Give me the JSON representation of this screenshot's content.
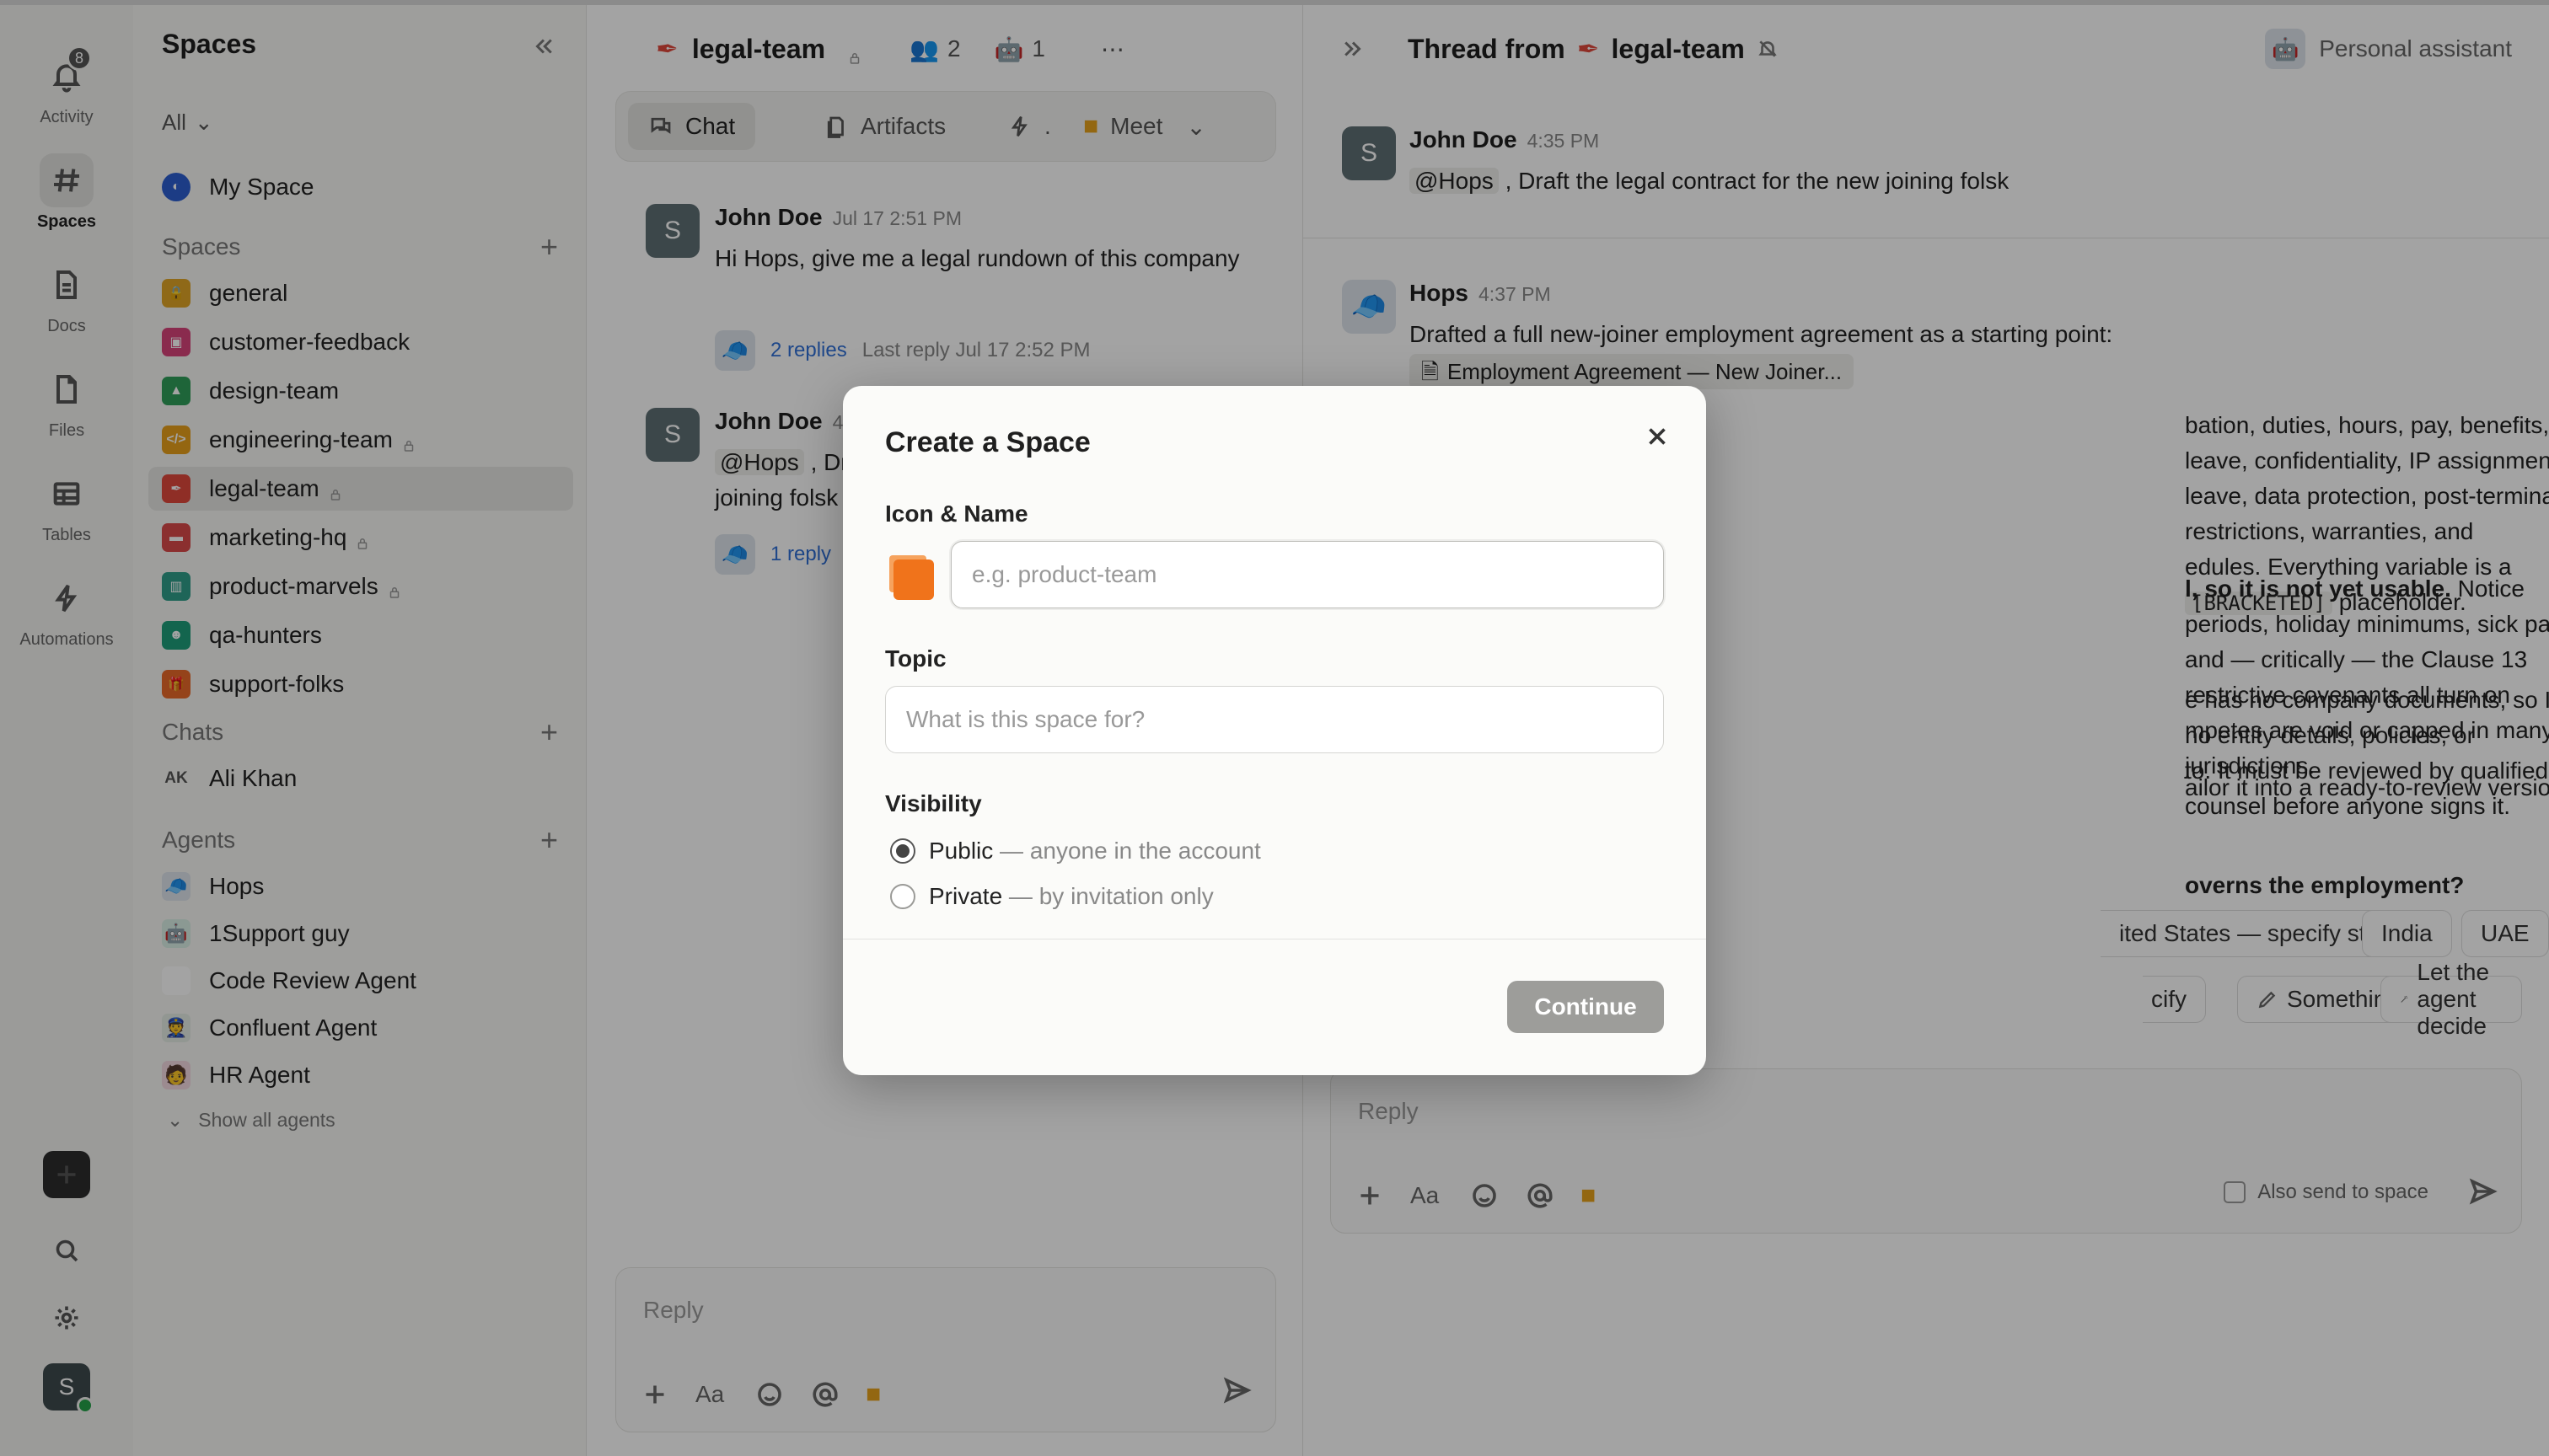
{
  "rail": {
    "activity": {
      "label": "Activity",
      "badge": "8"
    },
    "spaces": {
      "label": "Spaces"
    },
    "docs": {
      "label": "Docs"
    },
    "files": {
      "label": "Files"
    },
    "tables": {
      "label": "Tables"
    },
    "automations": {
      "label": "Automations"
    },
    "user_initial": "S"
  },
  "sidebar": {
    "title": "Spaces",
    "filter": "All",
    "my_space": "My Space",
    "spaces_header": "Spaces",
    "spaces": [
      {
        "name": "general",
        "color": "#e0a526",
        "private": false
      },
      {
        "name": "customer-feedback",
        "color": "#d8447a",
        "private": false
      },
      {
        "name": "design-team",
        "color": "#2f9e5a",
        "private": false
      },
      {
        "name": "engineering-team",
        "color": "#e8a01c",
        "private": true
      },
      {
        "name": "legal-team",
        "color": "#e0483c",
        "private": true
      },
      {
        "name": "marketing-hq",
        "color": "#d94a4a",
        "private": true
      },
      {
        "name": "product-marvels",
        "color": "#2f9e8a",
        "private": true
      },
      {
        "name": "qa-hunters",
        "color": "#1f9e7a",
        "private": false
      },
      {
        "name": "support-folks",
        "color": "#ea6a2a",
        "private": false
      }
    ],
    "chats_header": "Chats",
    "chats": [
      {
        "initials": "AK",
        "name": "Ali Khan"
      }
    ],
    "agents_header": "Agents",
    "agents": [
      "Hops",
      "1Support guy",
      "Code Review Agent",
      "Confluent Agent",
      "HR Agent"
    ],
    "show_all": "Show all agents"
  },
  "channel": {
    "name": "legal-team",
    "members": "2",
    "agents": "1",
    "tabs": {
      "chat": "Chat",
      "artifacts": "Artifacts",
      "meet": "Meet",
      "auto": "."
    },
    "messages": [
      {
        "initial": "S",
        "author": "John Doe",
        "time": "Jul 17 2:51 PM",
        "text": "Hi Hops, give me a legal rundown of this company",
        "replies": "2 replies",
        "last": "Last reply Jul 17 2:52 PM"
      },
      {
        "initial": "S",
        "author": "John Doe",
        "time": "4",
        "mention": "@Hops",
        "text_after": " , Dr",
        "text2": "joining folsk",
        "replies": "1 reply"
      }
    ],
    "reply_placeholder": "Reply",
    "aa": "Aa"
  },
  "thread": {
    "title_prefix": "Thread from",
    "space": "legal-team",
    "assistant": "Personal assistant",
    "root": {
      "initial": "S",
      "author": "John Doe",
      "time": "4:35 PM",
      "mention": "@Hops",
      "text": " , Draft the legal contract for the new joining folsk"
    },
    "reply": {
      "author": "Hops",
      "time": "4:37 PM",
      "intro": "Drafted a full new-joiner employment agreement as a starting point:",
      "file": "Employment Agreement — New Joiner...",
      "p1a": "bation, duties, hours, pay, benefits, leave, confidentiality, IP assignment,",
      "p1b": "leave, data protection, post-termination restrictions, warranties, and",
      "p1c": "edules. Everything variable is a",
      "p1code": "[BRACKETED]",
      "p1d": "placeholder.",
      "p2bold": "l, so it is not yet usable.",
      "p2a": " Notice periods, holiday minimums, sick pay, IP",
      "p2b": "and — critically — the Clause 13 restrictive covenants all turn on",
      "p2c": "mpetes are void or capped in many jurisdictions.",
      "p3a": "e has no company documents, so I had no entity details, policies, or",
      "p3b": "to. It must be reviewed by qualified counsel before anyone signs it.",
      "p4": "ailor it into a ready-to-review version.",
      "question": "overns the employment?",
      "options": [
        "ited States — specify state",
        "India",
        "UAE"
      ],
      "options2": [
        "cify",
        "Something else...",
        "Let the agent decide"
      ]
    },
    "reply_placeholder": "Reply",
    "aa": "Aa",
    "also_send": "Also send to space"
  },
  "modal": {
    "title": "Create a Space",
    "icon_name_label": "Icon & Name",
    "name_placeholder": "e.g. product-team",
    "topic_label": "Topic",
    "topic_placeholder": "What is this space for?",
    "visibility_label": "Visibility",
    "options": [
      {
        "label": "Public",
        "desc": " — anyone in the account",
        "checked": true
      },
      {
        "label": "Private",
        "desc": " — by invitation only",
        "checked": false
      }
    ],
    "continue_label": "Continue",
    "icon_color": "#f0731b"
  }
}
